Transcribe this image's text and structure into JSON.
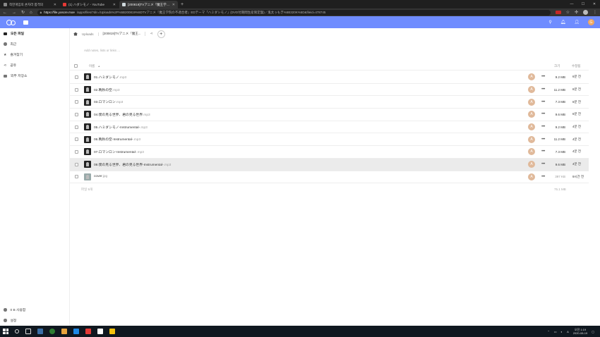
{
  "browser": {
    "tabs": [
      {
        "title": "착한게임의 손자라 합격의",
        "favicon": "page",
        "active": false
      },
      {
        "title": "(1) ハダシモノ - YouTube",
        "favicon": "youtube",
        "active": false
      },
      {
        "title": "[200819]TVアニメ『魔王学院の",
        "favicon": "nextcloud",
        "active": true
      }
    ],
    "new_tab": "+",
    "url_host": "https://file.yoscre.moe",
    "url_path": "/apps/files/?dir=/Uploads%2F%5B200819%5DTVアニメ『魔王学院の不適合者』EDテーマ「ハミダシモノ」(DVD付期間生産限定盤)／鬼太ぅもぎ%5B320K%5D&fileid=478745",
    "ext_label": "REC"
  },
  "header": {
    "avatar_letter": "G"
  },
  "sidebar": {
    "items": [
      {
        "label": "모든 파일",
        "icon": "folder-icon",
        "active": true
      },
      {
        "label": "최근",
        "icon": "clock-icon",
        "active": false
      },
      {
        "label": "즐겨찾기",
        "icon": "star-icon",
        "active": false
      },
      {
        "label": "공유",
        "icon": "share-icon",
        "active": false
      },
      {
        "label": "외부 저장소",
        "icon": "external-storage-icon",
        "active": false
      }
    ],
    "quota": "0 B 사용함",
    "settings": "설정"
  },
  "breadcrumb": {
    "uploads": "Uploads",
    "current": "[200819]TVアニメ『魔王...",
    "add": "+"
  },
  "notes_placeholder": "Add notes, lists or links ...",
  "table": {
    "headers": {
      "name": "이름",
      "sort": "▲",
      "size": "크기",
      "modified": "수정됨"
    },
    "files": [
      {
        "name": "01.ハミダシモノ",
        "ext": ".mp3",
        "size": "9.2 MB",
        "modified": "6분 전",
        "thumb": "audio",
        "share_letter": "A",
        "highlight": false
      },
      {
        "name": "02.晩秋の空",
        "ext": ".mp3",
        "size": "11.2 MB",
        "modified": "6분 전",
        "thumb": "audio",
        "share_letter": "A",
        "highlight": false
      },
      {
        "name": "03.ロマンロン",
        "ext": ".mp3",
        "size": "7.3 MB",
        "modified": "6분 전",
        "thumb": "audio",
        "share_letter": "A",
        "highlight": false
      },
      {
        "name": "04.僕の見る世界、君の見る世界",
        "ext": ".mp3",
        "size": "9.6 MB",
        "modified": "6분 전",
        "thumb": "audio",
        "share_letter": "A",
        "highlight": false
      },
      {
        "name": "05.ハミダシモノ-Instrumental-",
        "ext": ".mp3",
        "size": "9.2 MB",
        "modified": "4분 전",
        "thumb": "audio",
        "share_letter": "A",
        "highlight": false
      },
      {
        "name": "06.晩秋の空-Instrumental-",
        "ext": ".mp3",
        "size": "11.2 MB",
        "modified": "4분 전",
        "thumb": "audio",
        "share_letter": "A",
        "highlight": false
      },
      {
        "name": "07.ロマンロン-Instrumental-",
        "ext": ".mp3",
        "size": "7.3 MB",
        "modified": "4분 전",
        "thumb": "audio",
        "share_letter": "A",
        "highlight": false
      },
      {
        "name": "08.僕の見る世界、君の見る世界-Instrumental-",
        "ext": ".mp3",
        "size": "9.6 MB",
        "modified": "4분 전",
        "thumb": "audio",
        "share_letter": "A",
        "highlight": true
      },
      {
        "name": "cover",
        "ext": ".jpg",
        "size": "397 KB",
        "modified": "9시간 전",
        "thumb": "image",
        "share_letter": "A",
        "highlight": false,
        "muted_size": true
      }
    ],
    "summary_count": "파일 9개",
    "summary_total": "75.1 MB"
  },
  "taskbar": {
    "time": "오전 1:19",
    "date": "2020-08-19",
    "lang": "A",
    "colors": [
      "#3a6ea5",
      "#2e7d32",
      "#e8a33d",
      "#1e88e5",
      "#e53935",
      "#ffffff",
      "#f4c20d"
    ]
  }
}
